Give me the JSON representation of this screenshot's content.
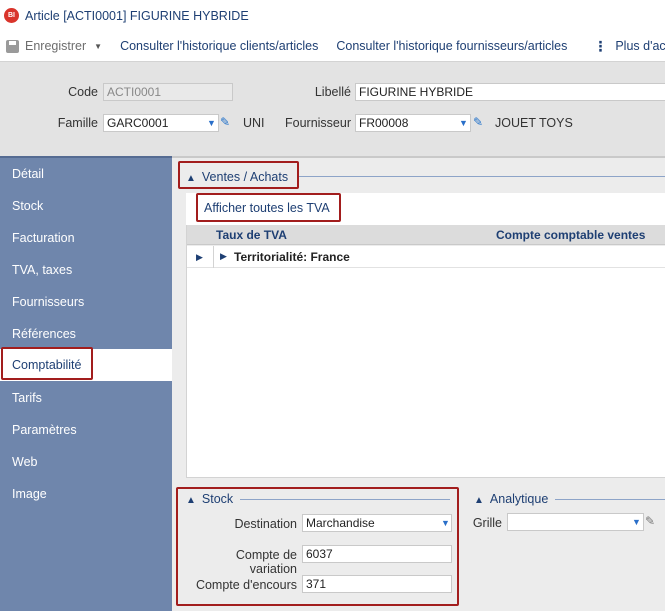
{
  "window": {
    "badge": "BI",
    "title": "Article [ACTI0001] FIGURINE HYBRIDE"
  },
  "toolbar": {
    "save_label": "Enregistrer",
    "history_clients": "Consulter l'historique clients/articles",
    "history_suppliers": "Consulter l'historique fournisseurs/articles",
    "more_actions": "Plus d'actions"
  },
  "header": {
    "code_label": "Code",
    "code_value": "ACTI0001",
    "libelle_label": "Libellé",
    "libelle_value": "FIGURINE HYBRIDE",
    "famille_label": "Famille",
    "famille_value": "GARC0001",
    "famille_desc": "UNI",
    "fournisseur_label": "Fournisseur",
    "fournisseur_value": "FR00008",
    "fournisseur_desc": "JOUET TOYS"
  },
  "sidebar": {
    "items": [
      {
        "label": "Détail",
        "active": false
      },
      {
        "label": "Stock",
        "active": false
      },
      {
        "label": "Facturation",
        "active": false
      },
      {
        "label": "TVA, taxes",
        "active": false
      },
      {
        "label": "Fournisseurs",
        "active": false
      },
      {
        "label": "Références",
        "active": false
      },
      {
        "label": "Comptabilité",
        "active": true
      },
      {
        "label": "Tarifs",
        "active": false
      },
      {
        "label": "Paramètres",
        "active": false
      },
      {
        "label": "Web",
        "active": false
      },
      {
        "label": "Image",
        "active": false
      }
    ]
  },
  "ventes": {
    "section_title": "Ventes / Achats",
    "show_all_vat": "Afficher toutes les TVA",
    "col_vat_rate": "Taux de TVA",
    "col_sales_account": "Compte comptable ventes",
    "row_group": "Territorialité: France"
  },
  "stock": {
    "section_title": "Stock",
    "destination_label": "Destination",
    "destination_value": "Marchandise",
    "variation_label": "Compte de variation",
    "variation_value": "6037",
    "encours_label": "Compte d'encours",
    "encours_value": "371"
  },
  "analytique": {
    "section_title": "Analytique",
    "grille_label": "Grille",
    "grille_value": ""
  },
  "colors": {
    "sidebar_bg": "#6f86ac",
    "accent": "#1e3f73",
    "highlight": "#a21d1d",
    "badge": "#d9342b"
  }
}
